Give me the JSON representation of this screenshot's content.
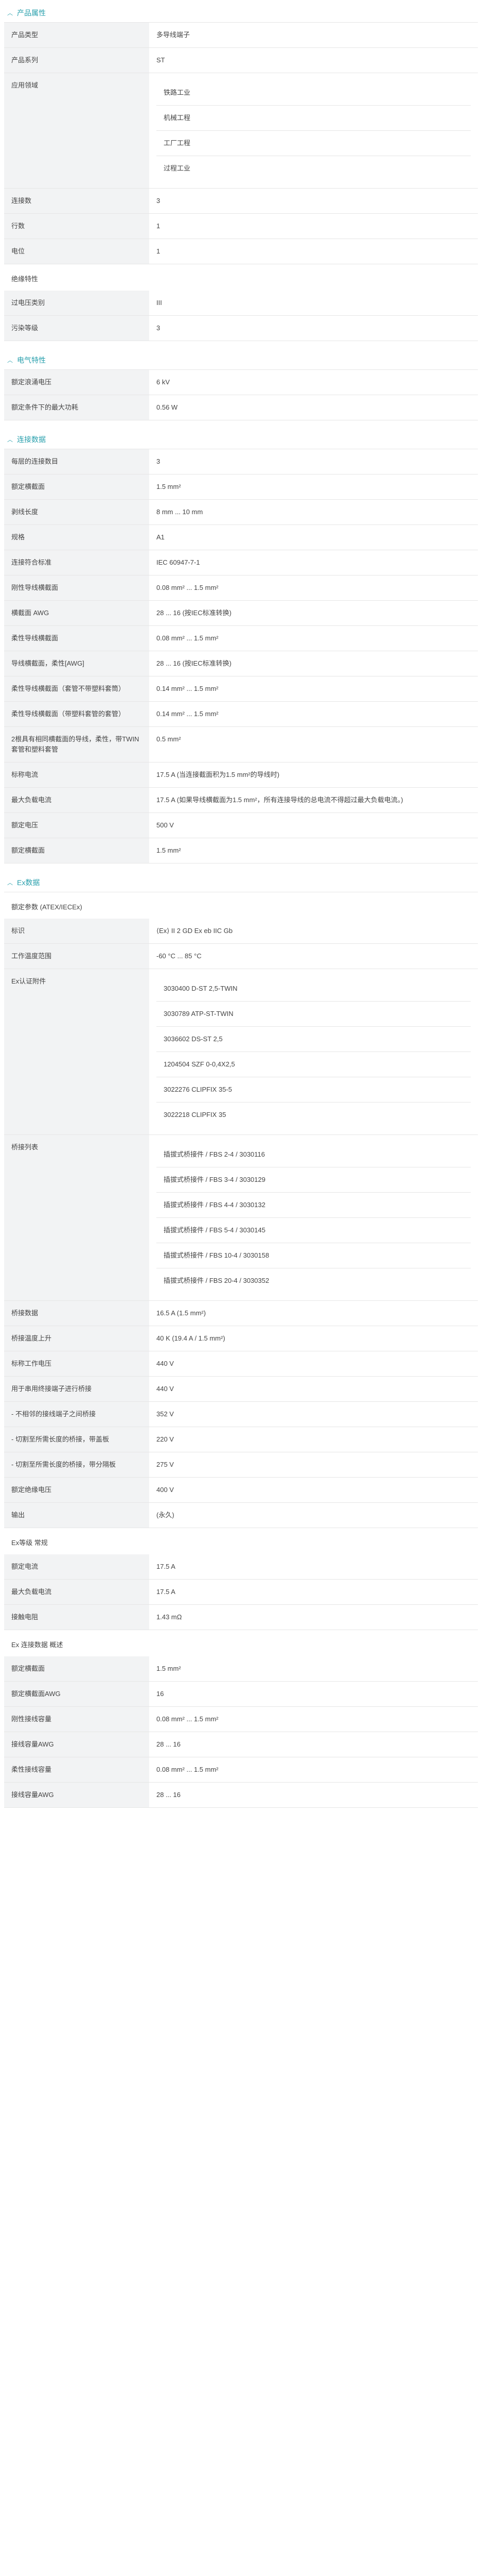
{
  "product": {
    "header": "产品属性",
    "rows": [
      {
        "k": "产品类型",
        "v": [
          "多导线端子"
        ]
      },
      {
        "k": "产品系列",
        "v": [
          "ST"
        ]
      },
      {
        "k": "应用领域",
        "v": [
          "铁路工业",
          "机械工程",
          "工厂工程",
          "过程工业"
        ]
      },
      {
        "k": "连接数",
        "v": [
          "3"
        ]
      },
      {
        "k": "行数",
        "v": [
          "1"
        ]
      },
      {
        "k": "电位",
        "v": [
          "1"
        ]
      }
    ],
    "insulation": {
      "title": "绝缘特性",
      "rows": [
        {
          "k": "过电压类别",
          "v": [
            "III"
          ]
        },
        {
          "k": "污染等级",
          "v": [
            "3"
          ]
        }
      ]
    }
  },
  "electrical": {
    "header": "电气特性",
    "rows": [
      {
        "k": "额定浪涌电压",
        "v": [
          "6 kV"
        ]
      },
      {
        "k": "额定条件下的最大功耗",
        "v": [
          "0.56 W"
        ]
      }
    ]
  },
  "connection": {
    "header": "连接数据",
    "rows": [
      {
        "k": "每层的连接数目",
        "v": [
          "3"
        ]
      },
      {
        "k": "额定横截面",
        "v": [
          "1.5 mm²"
        ]
      },
      {
        "k": "剥线长度",
        "v": [
          "8 mm ... 10 mm"
        ]
      },
      {
        "k": "规格",
        "v": [
          "A1"
        ]
      },
      {
        "k": "连接符合标准",
        "v": [
          "IEC 60947-7-1"
        ]
      },
      {
        "k": "刚性导线横截面",
        "v": [
          "0.08 mm² ... 1.5 mm²"
        ]
      },
      {
        "k": "横截面 AWG",
        "v": [
          "28 ... 16 (按IEC标准转换)"
        ]
      },
      {
        "k": "柔性导线横截面",
        "v": [
          "0.08 mm² ... 1.5 mm²"
        ]
      },
      {
        "k": "导线横截面，柔性[AWG]",
        "v": [
          "28 ... 16 (按IEC标准转换)"
        ]
      },
      {
        "k": "柔性导线横截面（套管不带塑料套筒）",
        "v": [
          "0.14 mm² ... 1.5 mm²"
        ]
      },
      {
        "k": "柔性导线横截面（带塑料套管的套管）",
        "v": [
          "0.14 mm² ... 1.5 mm²"
        ]
      },
      {
        "k": "2根具有相同横截面的导线，柔性，带TWIN套管和塑料套管",
        "v": [
          "0.5 mm²"
        ]
      },
      {
        "k": "标称电流",
        "v": [
          "17.5 A (当连接截面积为1.5 mm²的导线时)"
        ]
      },
      {
        "k": "最大负载电流",
        "v": [
          "17.5 A (如果导线横截面为1.5 mm²，所有连接导线的总电流不得超过最大负载电流。)"
        ]
      },
      {
        "k": "额定电压",
        "v": [
          "500 V"
        ]
      },
      {
        "k": "额定横截面",
        "v": [
          "1.5 mm²"
        ]
      }
    ]
  },
  "ex": {
    "header": "Ex数据",
    "approval": {
      "title": "额定参数 (ATEX/IECEx)",
      "rows": [
        {
          "k": "标识",
          "v": [
            "⟨Ex⟩ II 2 GD  Ex eb IIC Gb"
          ]
        },
        {
          "k": "工作温度范围",
          "v": [
            "-60 °C ... 85 °C"
          ]
        },
        {
          "k": "Ex认证附件",
          "v": [
            "3030400 D-ST 2,5-TWIN",
            "3030789 ATP-ST-TWIN",
            "3036602 DS-ST 2,5",
            "1204504 SZF 0-0,4X2,5",
            "3022276 CLIPFIX 35-5",
            "3022218 CLIPFIX 35"
          ]
        },
        {
          "k": "桥接列表",
          "v": [
            "插拔式桥接件 / FBS 2-4 / 3030116",
            "插拔式桥接件 / FBS 3-4 / 3030129",
            "插拔式桥接件 / FBS 4-4 / 3030132",
            "插拔式桥接件 / FBS 5-4 / 3030145",
            "插拔式桥接件 / FBS 10-4 / 3030158",
            "插拔式桥接件 / FBS 20-4 / 3030352"
          ]
        },
        {
          "k": "桥接数据",
          "v": [
            "16.5 A (1.5 mm²)"
          ]
        },
        {
          "k": "桥接温度上升",
          "v": [
            "40 K (19.4 A / 1.5 mm²)"
          ]
        },
        {
          "k": "标称工作电压",
          "v": [
            "440 V"
          ]
        },
        {
          "k": "用于串用终接端子进行桥接",
          "v": [
            "440 V"
          ]
        },
        {
          "k": "- 不相邻的接线端子之间桥接",
          "v": [
            "352 V"
          ]
        },
        {
          "k": "- 切割至所需长度的桥接，带盖板",
          "v": [
            "220 V"
          ]
        },
        {
          "k": "- 切割至所需长度的桥接，带分隔板",
          "v": [
            "275 V"
          ]
        },
        {
          "k": "额定绝缘电压",
          "v": [
            "400 V"
          ]
        },
        {
          "k": "输出",
          "v": [
            "(永久)"
          ]
        }
      ]
    },
    "level": {
      "title": "Ex等级 常规",
      "rows": [
        {
          "k": "额定电流",
          "v": [
            "17.5 A"
          ]
        },
        {
          "k": "最大负载电流",
          "v": [
            "17.5 A"
          ]
        },
        {
          "k": "接触电阻",
          "v": [
            "1.43 mΩ"
          ]
        }
      ]
    },
    "conn": {
      "title": "Ex 连接数据 概述",
      "rows": [
        {
          "k": "额定横截面",
          "v": [
            "1.5 mm²"
          ]
        },
        {
          "k": "额定横截面AWG",
          "v": [
            "16"
          ]
        },
        {
          "k": "刚性接线容量",
          "v": [
            "0.08 mm² ... 1.5 mm²"
          ]
        },
        {
          "k": "接线容量AWG",
          "v": [
            "28 ... 16"
          ]
        },
        {
          "k": "柔性接线容量",
          "v": [
            "0.08 mm² ... 1.5 mm²"
          ]
        },
        {
          "k": "接线容量AWG",
          "v": [
            "28 ... 16"
          ]
        }
      ]
    }
  }
}
